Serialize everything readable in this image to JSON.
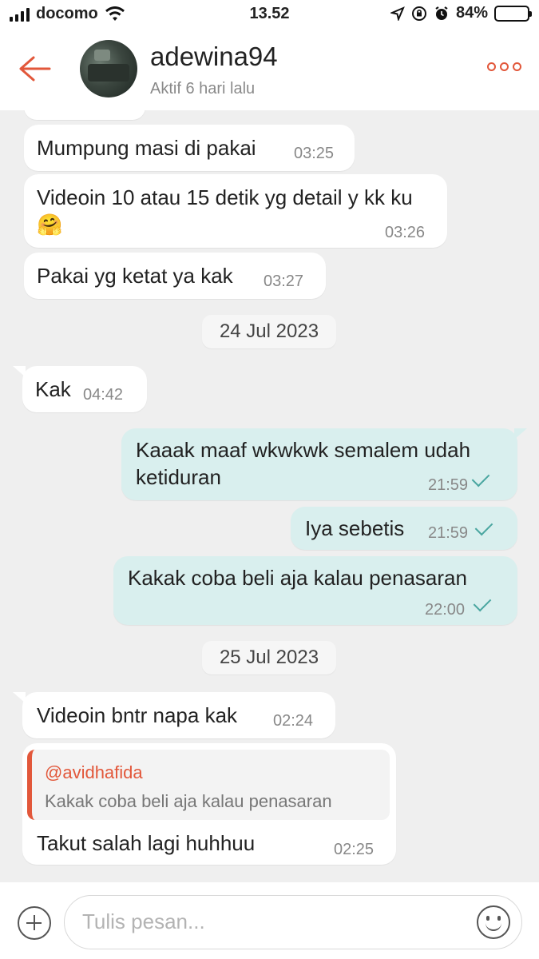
{
  "status_bar": {
    "carrier": "docomo",
    "time": "13.52",
    "battery": "84%",
    "battery_level": 0.84
  },
  "header": {
    "name": "adewina94",
    "presence": "Aktif 6 hari lalu"
  },
  "messages": [
    {
      "text": "Mumpung masi di pakai",
      "time": "03:25"
    },
    {
      "text": "Videoin 10 atau 15 detik yg detail y kk ku 🤗",
      "time": "03:26"
    },
    {
      "text": "Pakai yg ketat ya kak",
      "time": "03:27"
    },
    {
      "date": "24 Jul 2023"
    },
    {
      "text": "Kak",
      "time": "04:42"
    },
    {
      "text": "Kaaak maaf wkwkwk semalem udah ketiduran",
      "time": "21:59"
    },
    {
      "text": "Iya sebetis",
      "time": "21:59"
    },
    {
      "text": "Kakak coba beli aja kalau penasaran",
      "time": "22:00"
    },
    {
      "date": "25 Jul 2023"
    },
    {
      "text": "Videoin bntr napa kak",
      "time": "02:24"
    },
    {
      "quote_user": "@avidhafida",
      "quote_text": "Kakak coba beli aja kalau penasaran",
      "text": "Takut salah lagi huhhuu",
      "time": "02:25"
    }
  ],
  "composer": {
    "placeholder": "Tulis pesan..."
  },
  "icons": {
    "back": "arrow-left-icon",
    "more": "more-dots-icon",
    "attach": "plus-circle-icon",
    "emoji": "smiley-icon"
  },
  "colors": {
    "accent": "#e2573a",
    "outgoing_bubble": "#d9efee",
    "read_check": "#4aa6a0"
  }
}
